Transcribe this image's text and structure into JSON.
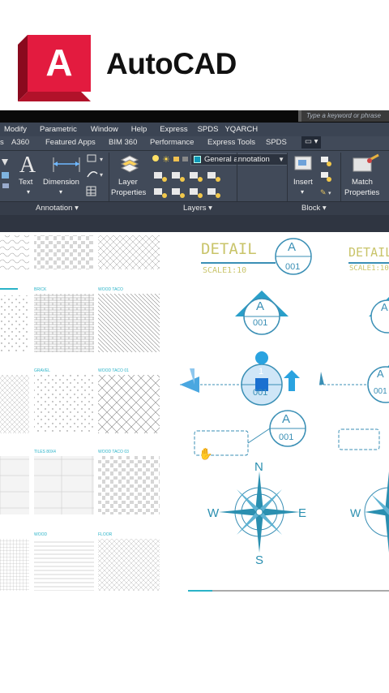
{
  "brand": {
    "name": "AutoCAD",
    "logo_letter": "A"
  },
  "titlebar": {
    "search_placeholder": "Type a keyword or phrase"
  },
  "menubar": {
    "items": [
      "Modify",
      "Parametric",
      "Window",
      "Help",
      "Express",
      "SPDS",
      "YQARCH"
    ]
  },
  "tabs": {
    "items": [
      "s",
      "A360",
      "Featured Apps",
      "BIM 360",
      "Performance",
      "Express Tools",
      "SPDS"
    ]
  },
  "ribbon": {
    "text_label": "Text",
    "dimension_label": "Dimension",
    "layer_properties_label": "Layer Properties",
    "layer_line1": "Layer",
    "layer_line2": "Properties",
    "layer_dropdown": "General annotation",
    "insert_label": "Insert",
    "match_line1": "Match",
    "match_line2": "Properties",
    "panels": {
      "annotation": "Annotation ▾",
      "layers": "Layers ▾",
      "block": "Block ▾"
    }
  },
  "hatches": {
    "labels": [
      "BRICK",
      "WOOD TACO",
      "GRAVEL",
      "WOOD TACO 01",
      "TILES 80X4",
      "WOOD TACO 03",
      "WOOD",
      "FLOOR"
    ]
  },
  "detail": {
    "title": "DETAIL",
    "scale": "SCALE1:10",
    "scale2": "SCALE1:10",
    "tag_letter": "A",
    "tag_number": "001",
    "marker_number": "1",
    "compass": {
      "n": "N",
      "s": "S",
      "e": "E",
      "w": "W"
    }
  },
  "colors": {
    "accent": "#3a8fb5",
    "detail_yellow": "#c9c46a",
    "logo_red": "#c8102e"
  }
}
